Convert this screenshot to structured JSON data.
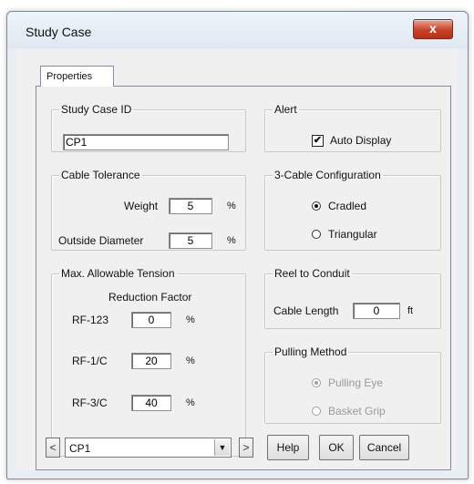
{
  "window": {
    "title": "Study Case",
    "close_glyph": "x"
  },
  "tabs": [
    {
      "label": "Properties",
      "active": true
    }
  ],
  "study_case_id": {
    "legend": "Study Case ID",
    "value": "CP1"
  },
  "alert": {
    "legend": "Alert",
    "auto_display_label": "Auto Display",
    "auto_display_checked": true,
    "check_glyph": "✔"
  },
  "cable_tolerance": {
    "legend": "Cable Tolerance",
    "weight_label": "Weight",
    "weight_value": "5",
    "weight_unit": "%",
    "outside_diameter_label": "Outside Diameter",
    "outside_diameter_value": "5",
    "outside_diameter_unit": "%"
  },
  "three_cable_configuration": {
    "legend": "3-Cable Configuration",
    "options": [
      {
        "label": "Cradled",
        "selected": true
      },
      {
        "label": "Triangular",
        "selected": false
      }
    ]
  },
  "max_allowable_tension": {
    "legend": "Max. Allowable Tension",
    "subheading": "Reduction Factor",
    "rows": [
      {
        "label": "RF-123",
        "value": "0",
        "unit": "%"
      },
      {
        "label": "RF-1/C",
        "value": "20",
        "unit": "%"
      },
      {
        "label": "RF-3/C",
        "value": "40",
        "unit": "%"
      }
    ]
  },
  "reel_to_conduit": {
    "legend": "Reel to Conduit",
    "cable_length_label": "Cable Length",
    "cable_length_value": "0",
    "cable_length_unit": "ft"
  },
  "pulling_method": {
    "legend": "Pulling Method",
    "enabled": false,
    "options": [
      {
        "label": "Pulling Eye",
        "selected": true
      },
      {
        "label": "Basket Grip",
        "selected": false
      }
    ]
  },
  "footer": {
    "prev_label": "<",
    "next_label": ">",
    "case_select_value": "CP1",
    "dropdown_glyph": "▼",
    "help_label": "Help",
    "ok_label": "OK",
    "cancel_label": "Cancel"
  },
  "colors": {
    "window_frame": "#e9eef4",
    "client_bg": "#f0f0f0",
    "close_button": "#c7422a",
    "disabled_text": "#9a9a9a"
  }
}
